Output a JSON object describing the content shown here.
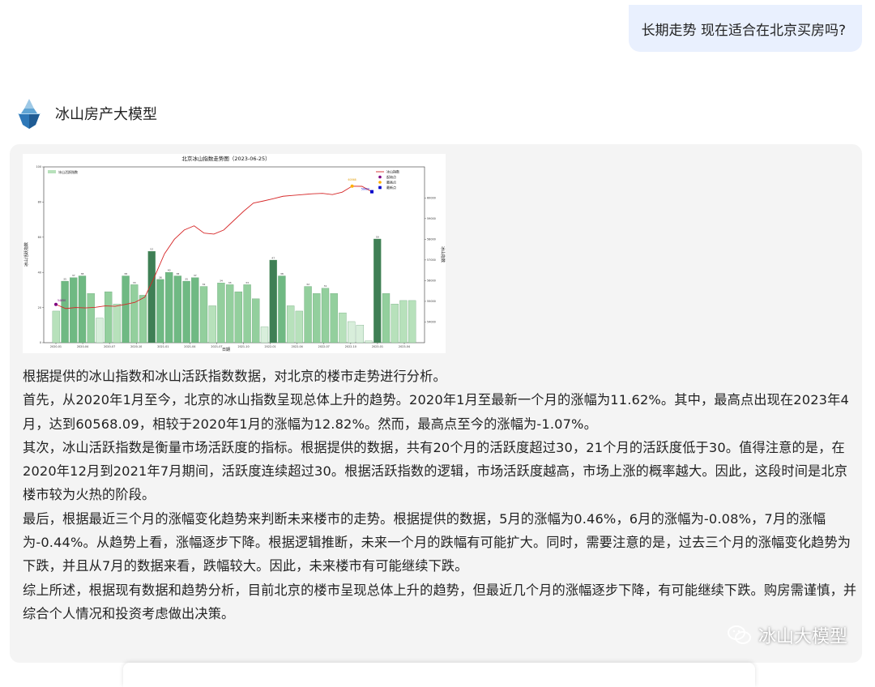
{
  "user_message": "长期走势 现在适合在北京买房吗?",
  "bot": {
    "name": "冰山房产大模型"
  },
  "chart_data": {
    "type": "bar+line",
    "title": "北京冰山指数走势图（2023-06-25）",
    "xlabel": "日期",
    "ylabel_left": "冰山活跃指数",
    "ylabel_right": "冰山指数",
    "legend_bar": "冰山活跃指数",
    "legend_line": [
      "冰山指数",
      "起始点",
      "最高点",
      "最新点"
    ],
    "ylim_left": [
      0,
      100
    ],
    "left_ticks": [
      "0",
      "20",
      "40",
      "60",
      "80",
      "100"
    ],
    "ylim_right": [
      53000,
      61500
    ],
    "right_ticks": [
      "54000",
      "55000",
      "56000",
      "57000",
      "58000",
      "59000",
      "60000"
    ],
    "x_ticks": [
      "2020-01",
      "2020-04",
      "2020-07",
      "2020-10",
      "2021-01",
      "2021-04",
      "2021-07",
      "2021-10",
      "2022-01",
      "2022-04",
      "2022-07",
      "2022-10",
      "2023-01",
      "2023-04"
    ],
    "activity": [
      18,
      35,
      37,
      38,
      28,
      14,
      29,
      22,
      38,
      33,
      27,
      52,
      36,
      40,
      38,
      35,
      37,
      32,
      21,
      34,
      33,
      29,
      33,
      25,
      9,
      47,
      38,
      21,
      18,
      32,
      28,
      31,
      28,
      17,
      12,
      10,
      1,
      59,
      28,
      22,
      24,
      24
    ],
    "index": [
      54850,
      54650,
      54700,
      54680,
      54710,
      54780,
      54760,
      54850,
      54950,
      55200,
      56200,
      57300,
      58000,
      58450,
      58650,
      58300,
      58250,
      58450,
      58900,
      59350,
      59750,
      59850,
      59960,
      60080,
      60120,
      60160,
      60200,
      60220,
      60160,
      60280,
      60568,
      60560,
      60300
    ],
    "start_label": "54850",
    "max_label": "60568",
    "latest_label": "59920"
  },
  "answer": {
    "p1": "根据提供的冰山指数和冰山活跃指数数据，对北京的楼市走势进行分析。",
    "p2": "首先，从2020年1月至今，北京的冰山指数呈现总体上升的趋势。2020年1月至最新一个月的涨幅为11.62%。其中，最高点出现在2023年4月，达到60568.09，相较于2020年1月的涨幅为12.82%。然而，最高点至今的涨幅为-1.07%。",
    "p3": "其次，冰山活跃指数是衡量市场活跃度的指标。根据提供的数据，共有20个月的活跃度超过30，21个月的活跃度低于30。值得注意的是，在2020年12月到2021年7月期间，活跃度连续超过30。根据活跃指数的逻辑，市场活跃度越高，市场上涨的概率越大。因此，这段时间是北京楼市较为火热的阶段。",
    "p4": "最后，根据最近三个月的涨幅变化趋势来判断未来楼市的走势。根据提供的数据，5月的涨幅为0.46%，6月的涨幅为-0.08%，7月的涨幅为-0.44%。从趋势上看，涨幅逐步下降。根据逻辑推断，未来一个月的跌幅有可能扩大。同时，需要注意的是，过去三个月的涨幅变化趋势为下跌，并且从7月的数据来看，跌幅较大。因此，未来楼市有可能继续下跌。",
    "p5": "综上所述，根据现有数据和趋势分析，目前北京的楼市呈现总体上升的趋势，但最近几个月的涨幅逐步下降，有可能继续下跌。购房需谨慎，并综合个人情况和投资考虑做出决策。"
  },
  "watermark": "冰山大模型",
  "colors": {
    "user_bubble": "#e9f0fe",
    "card_bg": "#f4f4f4",
    "line": "#d62728",
    "bar_dark": "#3a7d50"
  }
}
